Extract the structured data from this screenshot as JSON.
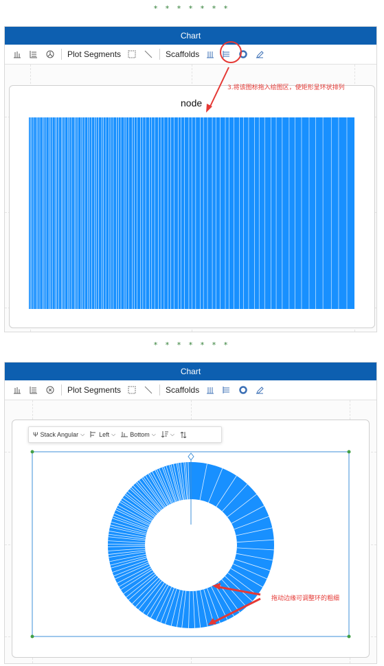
{
  "separator": "* * * * * * *",
  "panel": {
    "title": "Chart",
    "toolbar": {
      "plot_segments_label": "Plot Segments",
      "scaffolds_label": "Scaffolds"
    }
  },
  "top": {
    "node_title": "node",
    "annotation": "3.将该图标拖入绘图区，使矩形呈环状排列"
  },
  "bottom": {
    "popup": {
      "stack_label": "Stack Angular",
      "align_x_label": "Left",
      "align_y_label": "Bottom"
    },
    "annotation": "拖动边缘可调整环的粗细"
  },
  "colors": {
    "titlebar": "#0d5fb0",
    "bar_fill": "#1890ff",
    "annotation": "#e53935",
    "handle": "#43a047"
  },
  "icons": [
    "bar-chart-icon",
    "list-icon",
    "circle-icon",
    "rect-icon",
    "line-icon",
    "column-scaffold-icon",
    "row-scaffold-icon",
    "polar-scaffold-icon",
    "pen-icon"
  ]
}
